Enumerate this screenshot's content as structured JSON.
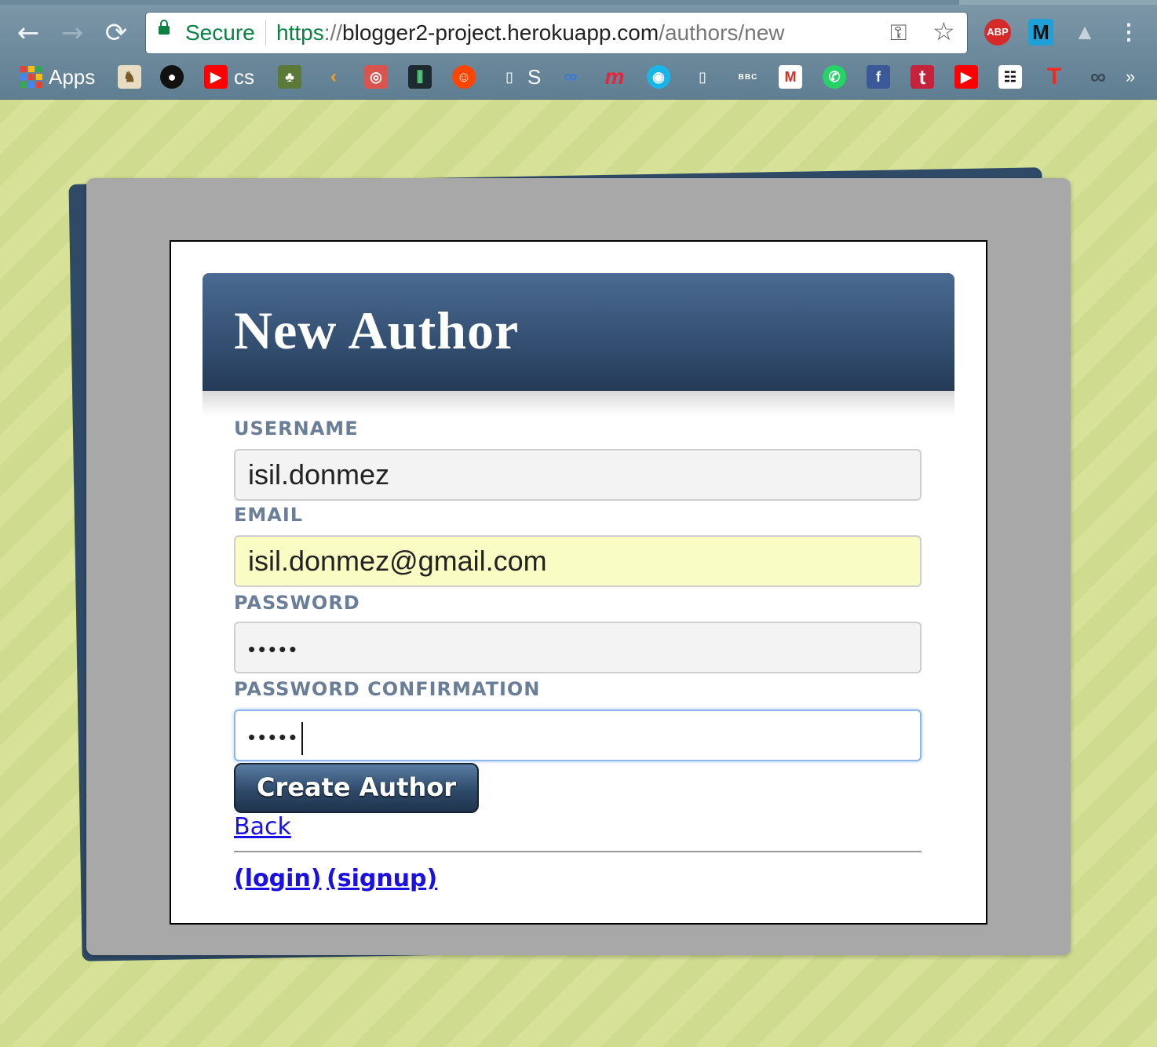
{
  "browser": {
    "secure_label": "Secure",
    "url_scheme": "https",
    "url_sep": "://",
    "url_host": "blogger2-project.herokuapp.com",
    "url_path": "/authors/new",
    "extensions": [
      "ABP",
      "M"
    ],
    "bookmarks": {
      "apps_label": "Apps",
      "cs_label": "cs",
      "s_label": "S",
      "bbc_label": "BBC",
      "more": "»"
    }
  },
  "page": {
    "title": "New Author",
    "username_label": "USERNAME",
    "username_value": "isil.donmez",
    "email_label": "EMAIL",
    "email_value": "isil.donmez@gmail.com",
    "password_label": "PASSWORD",
    "password_value": "•••••",
    "password_confirmation_label": "PASSWORD CONFIRMATION",
    "password_confirmation_value": "•••••",
    "submit_label": "Create Author",
    "back_label": "Back",
    "login_label": "(login)",
    "signup_label": "(signup)"
  }
}
